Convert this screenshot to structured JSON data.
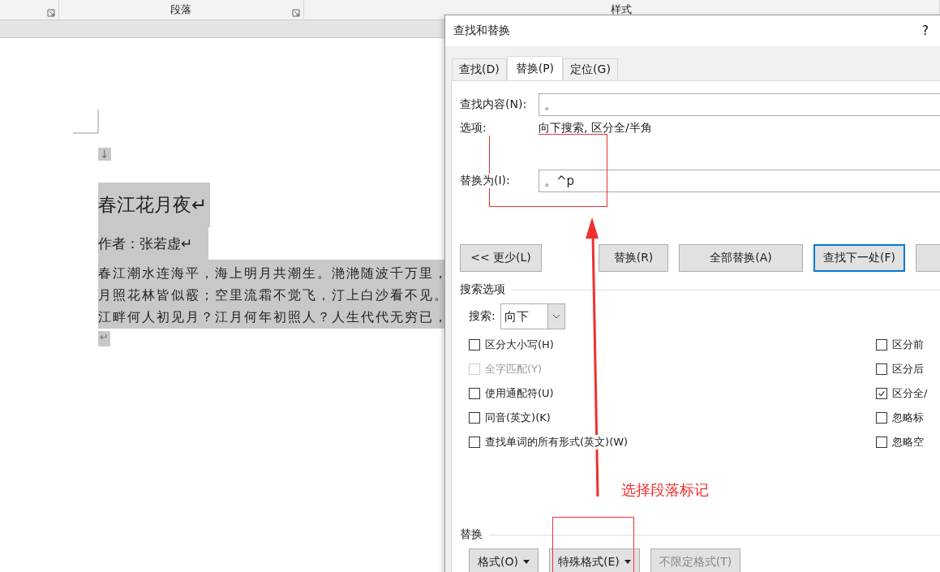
{
  "ribbon": {
    "groups": [
      {
        "label": "段落"
      },
      {
        "label": "样式"
      }
    ]
  },
  "document": {
    "top_mark": "↓",
    "title": "春江花月夜↵",
    "author": "作者：张若虚↵",
    "lines": [
      "春江潮水连海平，海上明月共潮生。滟滟随波千万里，",
      "月照花林皆似霰；空里流霜不觉飞，汀上白沙看不见。",
      "江畔何人初见月？江月何年初照人？人生代代无穷已，"
    ],
    "end_mark": "↵"
  },
  "dialog": {
    "title": "查找和替换",
    "help": "?",
    "tabs": [
      {
        "label": "查找(D)",
        "selected": false
      },
      {
        "label": "替换(P)",
        "selected": true
      },
      {
        "label": "定位(G)",
        "selected": false
      }
    ],
    "find": {
      "label": "查找内容(N):",
      "value": "。"
    },
    "options": {
      "label": "选项:",
      "value": "向下搜索, 区分全/半角"
    },
    "replace": {
      "label": "替换为(I):",
      "value": "。^p"
    },
    "buttons": [
      {
        "label": "<< 更少(L)",
        "focused": false
      },
      {
        "label": "替换(R)",
        "focused": false
      },
      {
        "label": "全部替换(A)",
        "focused": false
      },
      {
        "label": "查找下一处(F)",
        "focused": true
      }
    ],
    "search_options": {
      "title": "搜索选项",
      "direction_label": "搜索:",
      "direction": "向下",
      "left": [
        {
          "label": "区分大小写(H)",
          "checked": false,
          "disabled": false
        },
        {
          "label": "全字匹配(Y)",
          "checked": false,
          "disabled": true
        },
        {
          "label": "使用通配符(U)",
          "checked": false,
          "disabled": false
        },
        {
          "label": "同音(英文)(K)",
          "checked": false,
          "disabled": false
        },
        {
          "label": "查找单词的所有形式(英文)(W)",
          "checked": false,
          "disabled": false
        }
      ],
      "right": [
        {
          "label": "区分前",
          "checked": false,
          "disabled": false
        },
        {
          "label": "区分后",
          "checked": false,
          "disabled": false
        },
        {
          "label": "区分全/",
          "checked": true,
          "disabled": false
        },
        {
          "label": "忽略标",
          "checked": false,
          "disabled": false
        },
        {
          "label": "忽略空",
          "checked": false,
          "disabled": false
        }
      ]
    },
    "replace_section": {
      "title": "替换",
      "buttons": [
        {
          "label": "格式(O)",
          "dropdown": true,
          "disabled": false
        },
        {
          "label": "特殊格式(E)",
          "dropdown": true,
          "disabled": false
        },
        {
          "label": "不限定格式(T)",
          "dropdown": false,
          "disabled": true
        }
      ]
    }
  },
  "annotation": {
    "text": "选择段落标记"
  }
}
